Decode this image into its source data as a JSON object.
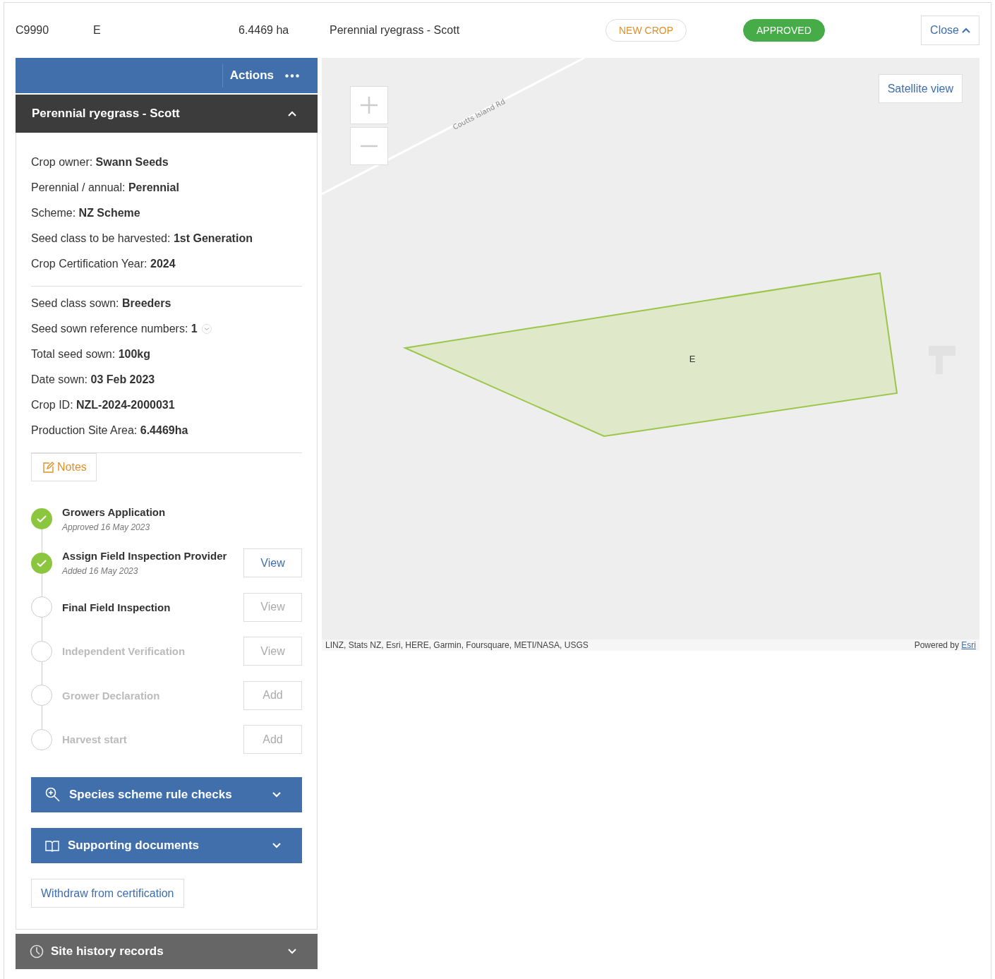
{
  "header": {
    "crop_code": "C9990",
    "paddock": "E",
    "area": "6.4469 ha",
    "crop": "Perennial ryegrass - Scott",
    "badges": [
      {
        "label": "NEW CROP",
        "kind": "outline"
      },
      {
        "label": "APPROVED",
        "kind": "solid"
      }
    ],
    "close_button": "Close"
  },
  "actions": {
    "label": "Actions"
  },
  "panel": {
    "title": "Perennial ryegrass - Scott",
    "expanded": true,
    "details_groups": [
      [
        {
          "label": "Crop owner: ",
          "value": "Swann Seeds"
        },
        {
          "label": "Perennial / annual: ",
          "value": "Perennial"
        },
        {
          "label": "Scheme: ",
          "value": "NZ Scheme"
        },
        {
          "label": "Seed class to be harvested: ",
          "value": "1st Generation"
        },
        {
          "label": "Crop Certification Year: ",
          "value": "2024"
        }
      ],
      [
        {
          "label": "Seed class sown: ",
          "value": "Breeders"
        },
        {
          "label": "Seed sown reference numbers: ",
          "value": "1",
          "dropdown": true
        },
        {
          "label": "Total seed sown: ",
          "value": "100kg"
        },
        {
          "label": "Date sown: ",
          "value": "03 Feb 2023"
        },
        {
          "label": "Crop ID: ",
          "value": "NZL-2024-2000031"
        },
        {
          "label": "Production Site Area: ",
          "value": "6.4469ha"
        }
      ]
    ],
    "notes_button": "Notes",
    "steps": [
      {
        "title": "Growers Application",
        "subtitle": "Approved 16 May 2023",
        "checked": true,
        "disabled": false
      },
      {
        "title": "Assign Field Inspection Provider",
        "subtitle": "Added 16 May 2023",
        "checked": true,
        "disabled": false,
        "action": "View"
      },
      {
        "title": "Final Field Inspection",
        "checked": false,
        "disabled": false,
        "action": "View"
      },
      {
        "title": "Independent Verification",
        "checked": false,
        "disabled": true,
        "action": "View"
      },
      {
        "title": "Grower Declaration",
        "checked": false,
        "disabled": true,
        "action": "Add"
      },
      {
        "title": "Harvest start",
        "checked": false,
        "disabled": true,
        "action": "Add"
      }
    ],
    "sections": [
      {
        "label": "Species scheme rule checks",
        "kind": "search"
      },
      {
        "label": "Supporting documents",
        "kind": "documents"
      }
    ],
    "withdraw_button": "Withdraw from certification"
  },
  "site_history": {
    "label": "Site history records"
  },
  "map": {
    "road_label": "Coutts Island Rd",
    "polygon_label": "E",
    "satellite_button": "Satellite view",
    "attribution": "LINZ, Stats NZ, Esri, HERE, Garmin, Foursquare, METI/NASA, USGS",
    "powered_by": "Powered by ",
    "powered_link": "Esri"
  }
}
